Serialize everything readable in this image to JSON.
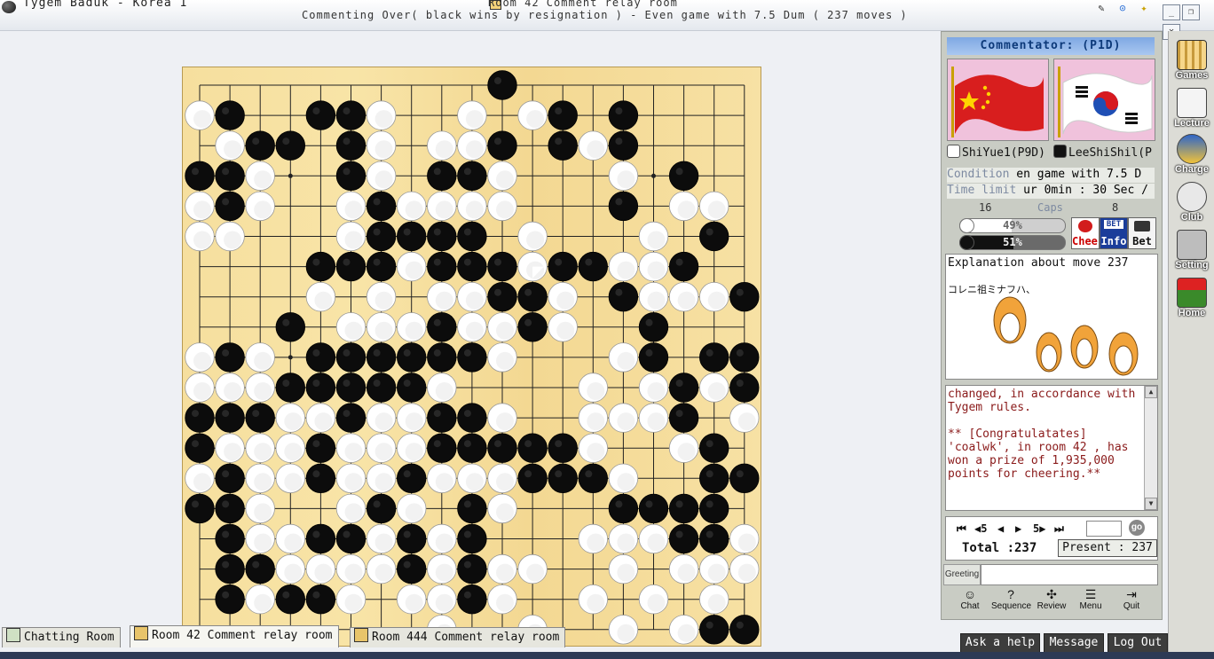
{
  "window": {
    "app_title": "Tygem Baduk - Korea 1",
    "room_title": "Room 42 Comment relay room",
    "status": "Commenting Over( black wins by resignation ) - Even game with 7.5 Dum  ( 237 moves )",
    "controls": [
      "_",
      "❐",
      "✕"
    ]
  },
  "sidebar": {
    "commentator": "Commentator: (P1D)",
    "white_player": "ShiYue1(P9D)",
    "black_player": "LeeShiShil(P",
    "condition_label": "Condition",
    "condition_value": "en game with 7.5 D",
    "timelimit_label": "Time limit",
    "timelimit_value": "ur 0min : 30 Sec /",
    "caps_label": "Caps",
    "caps_white": "16",
    "caps_black": "8",
    "cheer_white": "49%",
    "cheer_black": "51%",
    "cheer_white_value": 49,
    "cheer_black_value": 51,
    "buttons": {
      "cheer": "Cheer",
      "info": "Info",
      "bet": "Bet",
      "bet_badge": "BET"
    },
    "explanation_title": "Explanation about move 237",
    "explanation_text": "コレニ祖ミナフハ、",
    "chat_text": "changed, in accordance with Tygem rules.\n\n** [Congratulatates] 'coalwk', in room 42 , has won a prize of 1,935,000 points for cheering.**",
    "nav": {
      "first": "⏮",
      "back5": "◀5",
      "back": "◀",
      "fwd": "▶",
      "fwd5": "5▶",
      "last": "⏭",
      "go": "go"
    },
    "total": "Total :237",
    "present": "Present : 237",
    "greeting": "Greeting",
    "tools": [
      "Chat",
      "Sequence",
      "Review",
      "Menu",
      "Quit"
    ]
  },
  "rightbar": [
    "Games",
    "Lecture",
    "Charge",
    "Club",
    "Setting",
    "Home"
  ],
  "tabs": [
    "Chatting Room",
    "Room 42 Comment relay room",
    "Room 444 Comment relay room"
  ],
  "bottom_buttons": [
    "Ask a help",
    "Message",
    "Log Out"
  ],
  "board": {
    "size": 19,
    "last_move": [
      11,
      6
    ],
    "rows": [
      "..........X........",
      "OX..XXO..O.OX.X....",
      ".OXX.XO.OOX.XOX....",
      "XXO..XO.XXO...O.X..",
      "OXO..OXOOOO...X.OO.",
      "OO...OXXXX.O...O.X.",
      "....XXXOXXXOXXOOX..",
      "....O.O.OOXXO.XOOOX",
      "...X.OOOXOOXO..X...",
      "OXO.XXXXXXO...OX.XX",
      "OOOXXXXXO....O.OXOX",
      "XXXOOXOOXXO..OOOX.O",
      "XOOOXOOOXXXXXO..OX.",
      "OXOOXOOXOOOXXXO..XX",
      "XXO..OXO.XO...XXXX.O",
      ".XOOXXOXOX...OOOXXO",
      ".XXOOOOXOXOO..O.OOO",
      ".XOXXO.OOXO..O.O.O.",
      "........O..O..O.OXX"
    ]
  }
}
